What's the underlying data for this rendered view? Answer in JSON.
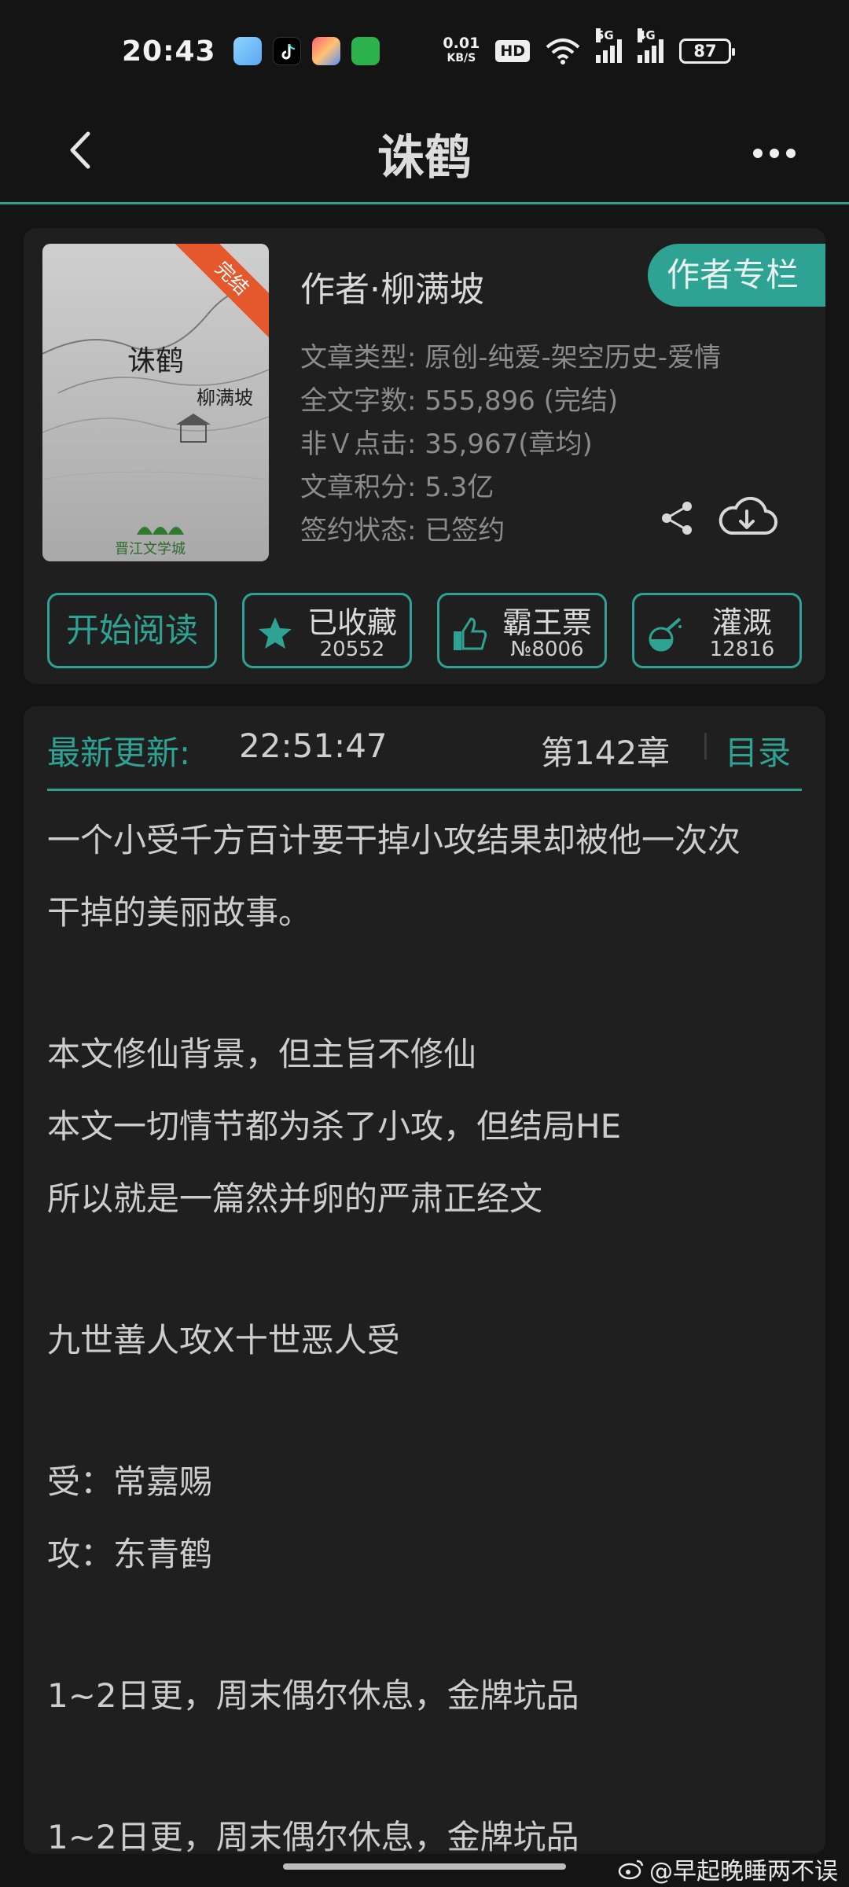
{
  "status_bar": {
    "time": "20:43",
    "net_speed_value": "0.01",
    "net_speed_unit": "KB/S",
    "hd_badge": "HD",
    "signal1_label": "5G",
    "signal2_label": "4G",
    "battery": "87",
    "app_icons": [
      "bunny-app-icon",
      "tiktok-icon",
      "colorful-app-icon",
      "green-app-icon"
    ]
  },
  "nav": {
    "title": "诛鹤"
  },
  "book": {
    "cover_title": "诛鹤",
    "cover_author": "柳满坡",
    "cover_ribbon": "完结",
    "cover_logo": "晋江文学城",
    "author_line": "作者·柳满坡",
    "author_column_button": "作者专栏",
    "meta": [
      "文章类型: 原创-纯爱-架空历史-爱情",
      "全文字数: 555,896 (完结)",
      "非Ｖ点击: 35,967(章均)",
      "文章积分: 5.3亿",
      "签约状态: 已签约"
    ]
  },
  "actions": {
    "start_reading": "开始阅读",
    "favorite_label": "已收藏",
    "favorite_count": "20552",
    "ticket_label": "霸王票",
    "ticket_rank": "№8006",
    "water_label": "灌溉",
    "water_count": "12816"
  },
  "update": {
    "label": "最新更新:",
    "time": "22:51:47",
    "chapter": "第142章",
    "toc": "目录"
  },
  "intro": {
    "lines": [
      "一个小受千方百计要干掉小攻结果却被他一次次",
      "干掉的美丽故事。",
      "",
      "本文修仙背景，但主旨不修仙",
      "本文一切情节都为杀了小攻，但结局HE",
      "所以就是一篇然并卵的严肃正经文",
      "",
      "九世善人攻X十世恶人受",
      "",
      "受：常嘉赐",
      "攻：东青鹤",
      "",
      "1~2日更，周末偶尔休息，金牌坑品",
      "",
      "1~2日更，周末偶尔休息，金牌坑品"
    ]
  },
  "watermark": "@早起晚睡两不误",
  "colors": {
    "accent": "#2fa393",
    "background": "#141414",
    "card": "#1f1f1f",
    "ribbon": "#e4582c"
  }
}
